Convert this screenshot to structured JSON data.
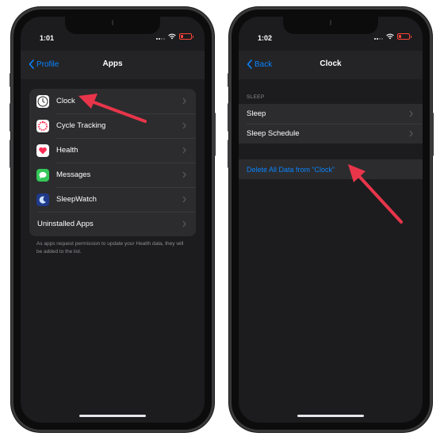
{
  "left_phone": {
    "status_time": "1:01",
    "nav": {
      "back_label": "Profile",
      "title": "Apps"
    },
    "apps": [
      {
        "label": "Clock",
        "icon": "clock-icon",
        "icon_bg": "#ffffff"
      },
      {
        "label": "Cycle Tracking",
        "icon": "cycle-tracking-icon",
        "icon_bg": "#ffffff"
      },
      {
        "label": "Health",
        "icon": "health-heart-icon",
        "icon_bg": "#ffffff"
      },
      {
        "label": "Messages",
        "icon": "messages-icon",
        "icon_bg": "#34c759"
      },
      {
        "label": "SleepWatch",
        "icon": "sleepwatch-icon",
        "icon_bg": "#1f3a8a"
      },
      {
        "label": "Uninstalled Apps"
      }
    ],
    "footnote": "As apps request permission to update your Health data, they will be added to the list."
  },
  "right_phone": {
    "status_time": "1:02",
    "nav": {
      "back_label": "Back",
      "title": "Clock"
    },
    "section_header": "SLEEP",
    "items": [
      {
        "label": "Sleep"
      },
      {
        "label": "Sleep Schedule"
      }
    ],
    "delete_label": "Delete All Data from “Clock”"
  },
  "colors": {
    "accent_blue": "#0a84ff",
    "annotation_arrow": "#e8354a",
    "battery_low": "#ff453a",
    "screen_bg": "#1c1c1e",
    "cell_bg": "#2c2c2e"
  }
}
